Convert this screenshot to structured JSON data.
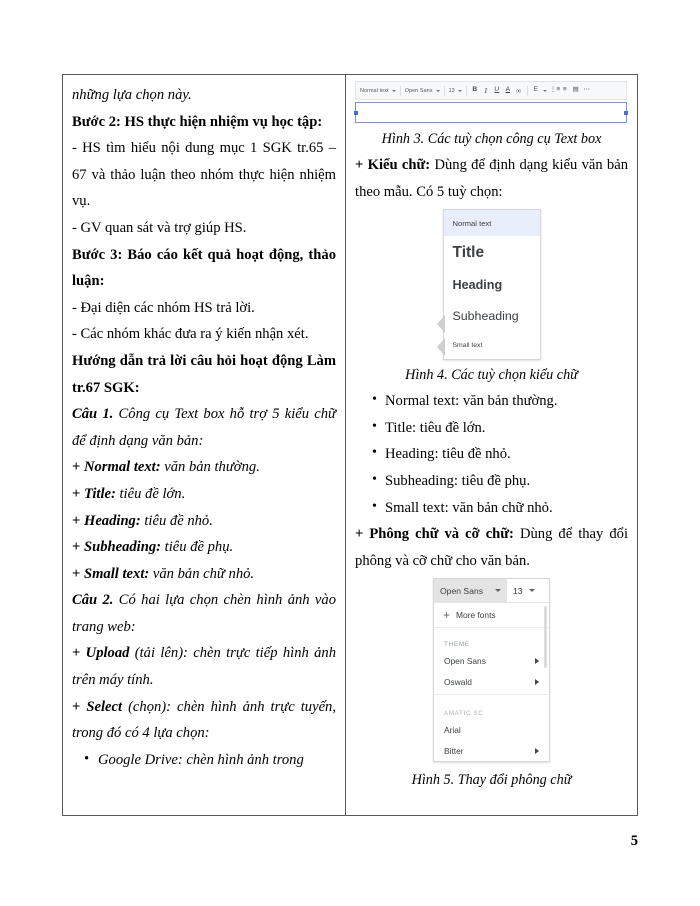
{
  "page": {
    "number": "5"
  },
  "left_column": {
    "paragraphs": [
      {
        "id": "p1",
        "segments": [
          {
            "text": "những lựa chọn này.",
            "style": "i"
          }
        ],
        "align": "left"
      },
      {
        "id": "p2",
        "segments": [
          {
            "text": "Bước 2: HS thực hiện nhiệm vụ học tập:",
            "style": "b"
          }
        ],
        "align": "justify"
      },
      {
        "id": "p3",
        "segments": [
          {
            "text": "- HS tìm hiểu nội dung mục 1 SGK tr.65 – 67 và thảo luận theo nhóm thực hiện nhiệm vụ.",
            "style": "n"
          }
        ],
        "align": "justify"
      },
      {
        "id": "p4",
        "segments": [
          {
            "text": "- GV quan sát và trợ giúp HS.",
            "style": "n"
          }
        ],
        "align": "left"
      },
      {
        "id": "p5",
        "segments": [
          {
            "text": "Bước 3: Báo cáo kết quả hoạt động, thảo luận:",
            "style": "b"
          }
        ],
        "align": "justify"
      },
      {
        "id": "p6",
        "segments": [
          {
            "text": "- Đại diện các nhóm HS trả lời.",
            "style": "n"
          }
        ],
        "align": "left"
      },
      {
        "id": "p7",
        "segments": [
          {
            "text": "- Các nhóm khác đưa ra ý kiến nhận xét.",
            "style": "n"
          }
        ],
        "align": "left"
      },
      {
        "id": "p8",
        "segments": [
          {
            "text": "Hướng dẫn trả lời câu hỏi hoạt động Làm tr.67 SGK:",
            "style": "b"
          }
        ],
        "align": "justify"
      },
      {
        "id": "p9",
        "segments": [
          {
            "text": "Câu 1.",
            "style": "bi"
          },
          {
            "text": " Công cụ Text box hỗ trợ 5 kiểu chữ để định dạng văn bản:",
            "style": "i"
          }
        ],
        "align": "justify"
      },
      {
        "id": "p10",
        "segments": [
          {
            "text": "+ ",
            "style": "b"
          },
          {
            "text": "Normal text:",
            "style": "bi"
          },
          {
            "text": " văn bản thường.",
            "style": "i"
          }
        ],
        "align": "left"
      },
      {
        "id": "p11",
        "segments": [
          {
            "text": "+ ",
            "style": "b"
          },
          {
            "text": "Title:",
            "style": "bi"
          },
          {
            "text": " tiêu đề lớn.",
            "style": "i"
          }
        ],
        "align": "left"
      },
      {
        "id": "p12",
        "segments": [
          {
            "text": "+ ",
            "style": "b"
          },
          {
            "text": "Heading:",
            "style": "bi"
          },
          {
            "text": " tiêu đề nhỏ.",
            "style": "i"
          }
        ],
        "align": "left"
      },
      {
        "id": "p13",
        "segments": [
          {
            "text": "+ ",
            "style": "b"
          },
          {
            "text": "Subheading:",
            "style": "bi"
          },
          {
            "text": " tiêu đề phụ.",
            "style": "i"
          }
        ],
        "align": "left"
      },
      {
        "id": "p14",
        "segments": [
          {
            "text": "+ ",
            "style": "b"
          },
          {
            "text": "Small text:",
            "style": "bi"
          },
          {
            "text": " văn bản chữ nhỏ.",
            "style": "i"
          }
        ],
        "align": "left"
      },
      {
        "id": "p15",
        "segments": [
          {
            "text": "Câu 2.",
            "style": "bi"
          },
          {
            "text": " Có hai lựa chọn chèn hình ảnh vào trang web:",
            "style": "i"
          }
        ],
        "align": "justify"
      },
      {
        "id": "p16",
        "segments": [
          {
            "text": "+ ",
            "style": "b"
          },
          {
            "text": "Upload",
            "style": "bi"
          },
          {
            "text": " (tải lên): chèn trực tiếp hình ảnh trên máy tính.",
            "style": "i"
          }
        ],
        "align": "justify"
      },
      {
        "id": "p17",
        "segments": [
          {
            "text": "+ ",
            "style": "b"
          },
          {
            "text": "Select",
            "style": "bi"
          },
          {
            "text": " (chọn): chèn hình ảnh trực tuyến, trong đó có 4 lựa chọn:",
            "style": "i"
          }
        ],
        "align": "justify"
      }
    ],
    "sub_bullet": "Google Drive: chèn hình ảnh trong"
  },
  "right_column": {
    "figure3": {
      "toolbar": {
        "style_label": "Normal text",
        "font_label": "Open Sans",
        "size_label": "13",
        "bold": "B",
        "italic": "I",
        "underline": "U",
        "text_color": "A",
        "link": "∞",
        "align": "E",
        "list_numbered": "⋮≡",
        "list_bulleted": "≡",
        "indent": "▤",
        "more": "⋯"
      }
    },
    "caption3": "Hình 3. Các tuỳ chọn công cụ Text box",
    "para_kieu_chu": [
      {
        "text": "+ ",
        "style": "b"
      },
      {
        "text": "Kiểu chữ:",
        "style": "b"
      },
      {
        "text": " Dùng để định dạng kiểu văn bản theo mẫu. Có 5 tuỳ chọn:",
        "style": "n"
      }
    ],
    "figure4": {
      "options": [
        {
          "label": "Normal text",
          "selected": true
        },
        {
          "label": "Title",
          "selected": false
        },
        {
          "label": "Heading",
          "selected": false
        },
        {
          "label": "Subheading",
          "selected": false
        },
        {
          "label": "Small text",
          "selected": false
        }
      ]
    },
    "caption4": "Hình 4. Các tuỳ chọn kiểu chữ",
    "bullets": [
      "Normal text: văn bản thường.",
      "Title: tiêu đề lớn.",
      "Heading: tiêu đề nhỏ.",
      "Subheading: tiêu đề phụ.",
      "Small text: văn bản chữ nhỏ."
    ],
    "para_phong_chu": [
      {
        "text": "+ ",
        "style": "b"
      },
      {
        "text": "Phông chữ và cỡ chữ:",
        "style": "b"
      },
      {
        "text": " Dùng để thay đổi phông và cỡ chữ cho văn bản.",
        "style": "n"
      }
    ],
    "figure5": {
      "font_current": "Open Sans",
      "size_current": "13",
      "more_fonts": "More fonts",
      "group_theme": "THEME",
      "theme_fonts": [
        "Open Sans",
        "Oswald"
      ],
      "group_amatic": "AMATIC SC",
      "other_fonts": [
        "Arial",
        "Bitter"
      ]
    },
    "caption5": "Hình 5. Thay đổi phông chữ"
  }
}
